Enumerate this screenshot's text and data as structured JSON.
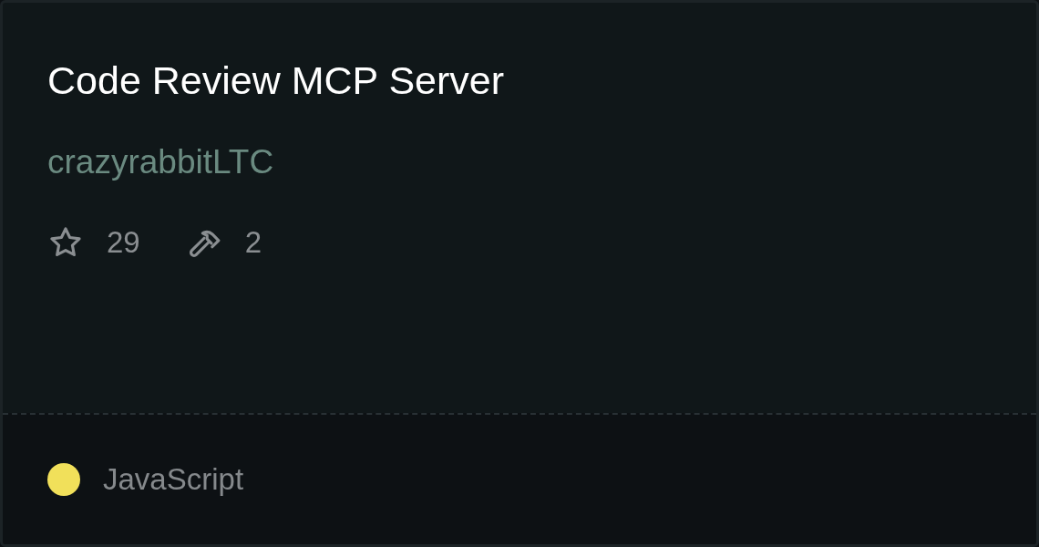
{
  "title": "Code Review MCP Server",
  "author": "crazyrabbitLTC",
  "stats": [
    {
      "kind": "stars",
      "value": "29"
    },
    {
      "kind": "tools",
      "value": "2"
    }
  ],
  "language": {
    "name": "JavaScript",
    "color": "#f1e05a"
  }
}
